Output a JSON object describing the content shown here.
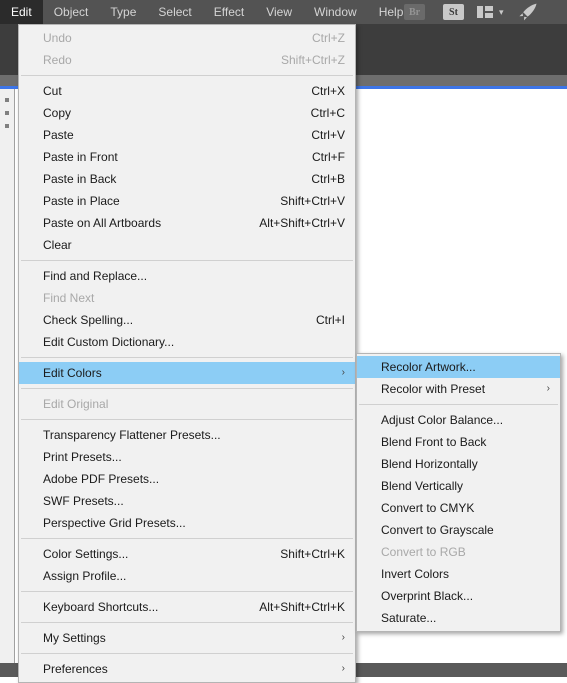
{
  "app": {
    "menubar": {
      "items": [
        {
          "label": "Edit",
          "name": "menubar-item-edit",
          "active": true
        },
        {
          "label": "Object",
          "name": "menubar-item-object",
          "active": false
        },
        {
          "label": "Type",
          "name": "menubar-item-type",
          "active": false
        },
        {
          "label": "Select",
          "name": "menubar-item-select",
          "active": false
        },
        {
          "label": "Effect",
          "name": "menubar-item-effect",
          "active": false
        },
        {
          "label": "View",
          "name": "menubar-item-view",
          "active": false
        },
        {
          "label": "Window",
          "name": "menubar-item-window",
          "active": false
        },
        {
          "label": "Help",
          "name": "menubar-item-help",
          "active": false
        }
      ],
      "tools": {
        "bridge_label": "Br",
        "stock_label": "St",
        "arrange_icon": "arrange-documents-icon",
        "chevron_icon": "chevron-down-icon",
        "rocket_icon": "rocket-icon"
      }
    },
    "colors": {
      "menubar_bg": "#535353",
      "toolbar_bg": "#3d3d3d",
      "control_strip_bg": "#6e6e6e",
      "accent_rule": "#3d75e8",
      "menu_bg": "#f1f1f1",
      "menu_border": "#b4b4b4",
      "highlight": "#8ccdf5",
      "disabled_text": "#a8a8a8",
      "text": "#1a1a1a"
    }
  },
  "edit_menu": {
    "name": "edit-menu",
    "groups": [
      {
        "items": [
          {
            "label": "Undo",
            "shortcut": "Ctrl+Z",
            "disabled": true,
            "submenu": false,
            "highlight": false
          },
          {
            "label": "Redo",
            "shortcut": "Shift+Ctrl+Z",
            "disabled": true,
            "submenu": false,
            "highlight": false
          }
        ]
      },
      {
        "items": [
          {
            "label": "Cut",
            "shortcut": "Ctrl+X",
            "disabled": false,
            "submenu": false,
            "highlight": false
          },
          {
            "label": "Copy",
            "shortcut": "Ctrl+C",
            "disabled": false,
            "submenu": false,
            "highlight": false
          },
          {
            "label": "Paste",
            "shortcut": "Ctrl+V",
            "disabled": false,
            "submenu": false,
            "highlight": false
          },
          {
            "label": "Paste in Front",
            "shortcut": "Ctrl+F",
            "disabled": false,
            "submenu": false,
            "highlight": false
          },
          {
            "label": "Paste in Back",
            "shortcut": "Ctrl+B",
            "disabled": false,
            "submenu": false,
            "highlight": false
          },
          {
            "label": "Paste in Place",
            "shortcut": "Shift+Ctrl+V",
            "disabled": false,
            "submenu": false,
            "highlight": false
          },
          {
            "label": "Paste on All Artboards",
            "shortcut": "Alt+Shift+Ctrl+V",
            "disabled": false,
            "submenu": false,
            "highlight": false
          },
          {
            "label": "Clear",
            "shortcut": "",
            "disabled": false,
            "submenu": false,
            "highlight": false
          }
        ]
      },
      {
        "items": [
          {
            "label": "Find and Replace...",
            "shortcut": "",
            "disabled": false,
            "submenu": false,
            "highlight": false
          },
          {
            "label": "Find Next",
            "shortcut": "",
            "disabled": true,
            "submenu": false,
            "highlight": false
          },
          {
            "label": "Check Spelling...",
            "shortcut": "Ctrl+I",
            "disabled": false,
            "submenu": false,
            "highlight": false
          },
          {
            "label": "Edit Custom Dictionary...",
            "shortcut": "",
            "disabled": false,
            "submenu": false,
            "highlight": false
          }
        ]
      },
      {
        "items": [
          {
            "label": "Edit Colors",
            "shortcut": "",
            "disabled": false,
            "submenu": true,
            "highlight": true
          }
        ]
      },
      {
        "items": [
          {
            "label": "Edit Original",
            "shortcut": "",
            "disabled": true,
            "submenu": false,
            "highlight": false
          }
        ]
      },
      {
        "items": [
          {
            "label": "Transparency Flattener Presets...",
            "shortcut": "",
            "disabled": false,
            "submenu": false,
            "highlight": false
          },
          {
            "label": "Print Presets...",
            "shortcut": "",
            "disabled": false,
            "submenu": false,
            "highlight": false
          },
          {
            "label": "Adobe PDF Presets...",
            "shortcut": "",
            "disabled": false,
            "submenu": false,
            "highlight": false
          },
          {
            "label": "SWF Presets...",
            "shortcut": "",
            "disabled": false,
            "submenu": false,
            "highlight": false
          },
          {
            "label": "Perspective Grid Presets...",
            "shortcut": "",
            "disabled": false,
            "submenu": false,
            "highlight": false
          }
        ]
      },
      {
        "items": [
          {
            "label": "Color Settings...",
            "shortcut": "Shift+Ctrl+K",
            "disabled": false,
            "submenu": false,
            "highlight": false
          },
          {
            "label": "Assign Profile...",
            "shortcut": "",
            "disabled": false,
            "submenu": false,
            "highlight": false
          }
        ]
      },
      {
        "items": [
          {
            "label": "Keyboard Shortcuts...",
            "shortcut": "Alt+Shift+Ctrl+K",
            "disabled": false,
            "submenu": false,
            "highlight": false
          }
        ]
      },
      {
        "items": [
          {
            "label": "My Settings",
            "shortcut": "",
            "disabled": false,
            "submenu": true,
            "highlight": false
          }
        ]
      },
      {
        "items": [
          {
            "label": "Preferences",
            "shortcut": "",
            "disabled": false,
            "submenu": true,
            "highlight": false
          }
        ]
      }
    ]
  },
  "edit_colors_submenu": {
    "name": "edit-colors-submenu",
    "groups": [
      {
        "items": [
          {
            "label": "Recolor Artwork...",
            "shortcut": "",
            "disabled": false,
            "submenu": false,
            "highlight": true
          },
          {
            "label": "Recolor with Preset",
            "shortcut": "",
            "disabled": false,
            "submenu": true,
            "highlight": false
          }
        ]
      },
      {
        "items": [
          {
            "label": "Adjust Color Balance...",
            "shortcut": "",
            "disabled": false,
            "submenu": false,
            "highlight": false
          },
          {
            "label": "Blend Front to Back",
            "shortcut": "",
            "disabled": false,
            "submenu": false,
            "highlight": false
          },
          {
            "label": "Blend Horizontally",
            "shortcut": "",
            "disabled": false,
            "submenu": false,
            "highlight": false
          },
          {
            "label": "Blend Vertically",
            "shortcut": "",
            "disabled": false,
            "submenu": false,
            "highlight": false
          },
          {
            "label": "Convert to CMYK",
            "shortcut": "",
            "disabled": false,
            "submenu": false,
            "highlight": false
          },
          {
            "label": "Convert to Grayscale",
            "shortcut": "",
            "disabled": false,
            "submenu": false,
            "highlight": false
          },
          {
            "label": "Convert to RGB",
            "shortcut": "",
            "disabled": true,
            "submenu": false,
            "highlight": false
          },
          {
            "label": "Invert Colors",
            "shortcut": "",
            "disabled": false,
            "submenu": false,
            "highlight": false
          },
          {
            "label": "Overprint Black...",
            "shortcut": "",
            "disabled": false,
            "submenu": false,
            "highlight": false
          },
          {
            "label": "Saturate...",
            "shortcut": "",
            "disabled": false,
            "submenu": false,
            "highlight": false
          }
        ]
      }
    ]
  },
  "icons": {
    "submenu_arrow": "›",
    "chevron_down": "⌄"
  }
}
